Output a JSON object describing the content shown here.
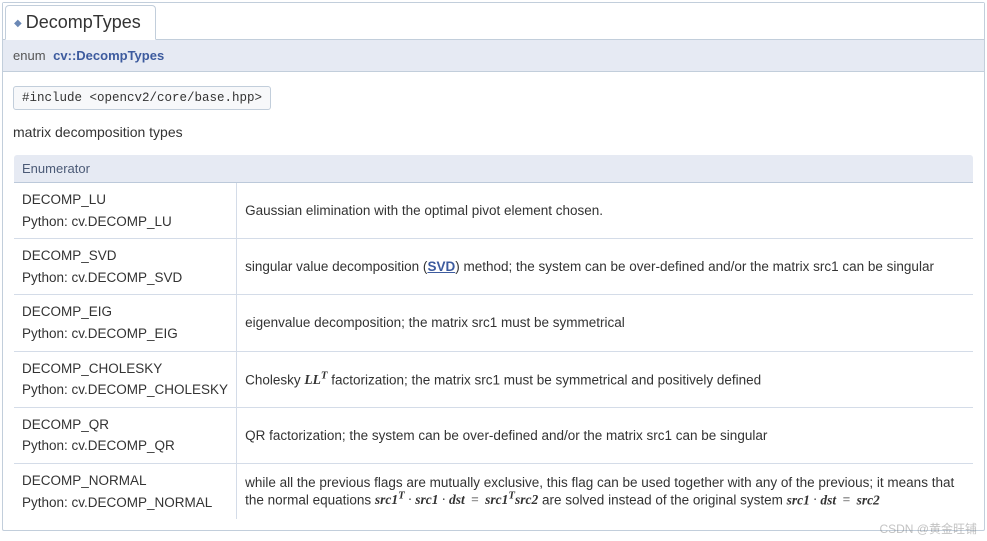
{
  "tab_title": "DecompTypes",
  "signature": {
    "keyword": "enum",
    "qualified": "cv::DecompTypes"
  },
  "include_text": "#include <opencv2/core/base.hpp>",
  "description": "matrix decomposition types",
  "table": {
    "header": "Enumerator",
    "rows": [
      {
        "name": "DECOMP_LU",
        "python": "Python: cv.DECOMP_LU",
        "desc_plain": "Gaussian elimination with the optimal pivot element chosen."
      },
      {
        "name": "DECOMP_SVD",
        "python": "Python: cv.DECOMP_SVD",
        "desc_pre": "singular value decomposition (",
        "desc_link": "SVD",
        "desc_post": ") method; the system can be over-defined and/or the matrix src1 can be singular"
      },
      {
        "name": "DECOMP_EIG",
        "python": "Python: cv.DECOMP_EIG",
        "desc_plain": "eigenvalue decomposition; the matrix src1 must be symmetrical"
      },
      {
        "name": "DECOMP_CHOLESKY",
        "python": "Python: cv.DECOMP_CHOLESKY",
        "desc_pre": "Cholesky ",
        "desc_math": "LL",
        "desc_sup": "T",
        "desc_post": " factorization; the matrix src1 must be symmetrical and positively defined"
      },
      {
        "name": "DECOMP_QR",
        "python": "Python: cv.DECOMP_QR",
        "desc_plain": "QR factorization; the system can be over-defined and/or the matrix src1 can be singular"
      },
      {
        "name": "DECOMP_NORMAL",
        "python": "Python: cv.DECOMP_NORMAL",
        "desc_pre": "while all the previous flags are mutually exclusive, this flag can be used together with any of the previous; it means that the normal equations ",
        "eq1_lhs": "src1",
        "eq1_sup": "T",
        "eq1_mid1": "src1",
        "eq1_mid2": "dst",
        "eq1_rhs1": "src1",
        "eq1_rhs_sup": "T",
        "eq1_rhs2": "src2",
        "desc_mid": " are solved instead of the original system ",
        "eq2_a": "src1",
        "eq2_b": "dst",
        "eq2_c": "src2"
      }
    ]
  },
  "watermark": "CSDN @黄金旺铺"
}
